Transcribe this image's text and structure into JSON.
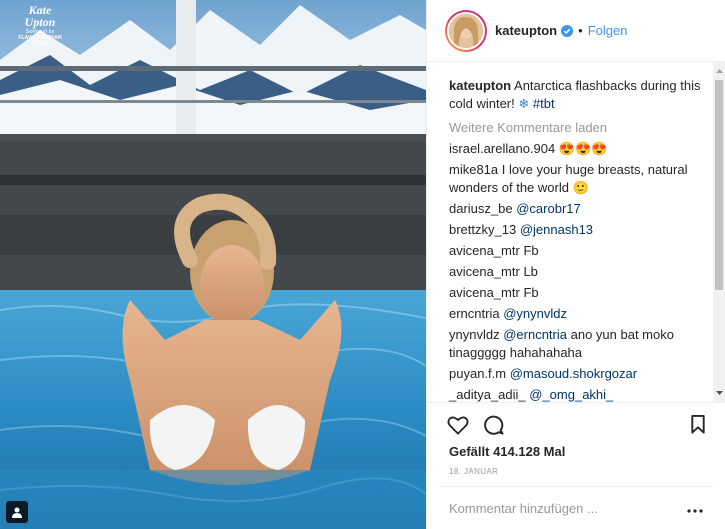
{
  "photo": {
    "watermark_title_1": "Kate",
    "watermark_title_2": "Upton",
    "watermark_line": "Swimsuit by",
    "watermark_brand": "FLAVIA PADOVAN",
    "watermark_code": "(Y260)",
    "tag_icon": "user-tag-icon"
  },
  "header": {
    "username": "kateupton",
    "verified_icon": "verified-badge-icon",
    "separator": "•",
    "follow_label": "Folgen"
  },
  "caption": {
    "user": "kateupton",
    "text": "Antarctica flashbacks during this cold winter!",
    "emoji": "❄",
    "hashtag": "#tbt"
  },
  "load_more_label": "Weitere Kommentare laden",
  "comments": [
    {
      "user": "israel.arellano.904",
      "mention": "",
      "text": "😍😍😍"
    },
    {
      "user": "mike81a",
      "mention": "",
      "text": "I love your huge breasts, natural wonders of the world 🙂"
    },
    {
      "user": "dariusz_be",
      "mention": "@carobr17",
      "text": ""
    },
    {
      "user": "brettzky_13",
      "mention": "@jennash13",
      "text": ""
    },
    {
      "user": "avicena_mtr",
      "mention": "",
      "text": "Fb"
    },
    {
      "user": "avicena_mtr",
      "mention": "",
      "text": "Lb"
    },
    {
      "user": "avicena_mtr",
      "mention": "",
      "text": "Fb"
    },
    {
      "user": "erncntria",
      "mention": "@ynynvldz",
      "text": ""
    },
    {
      "user": "ynynvldz",
      "mention": "@erncntria",
      "text": "ano yun bat moko tinaggggg hahahahaha"
    },
    {
      "user": "puyan.f.m",
      "mention": "@masoud.shokrgozar",
      "text": ""
    },
    {
      "user": "_aditya_adii_",
      "mention": "@_omg_akhi_",
      "text": ""
    }
  ],
  "actions": {
    "like_icon": "heart-icon",
    "comment_icon": "comment-bubble-icon",
    "save_icon": "bookmark-icon"
  },
  "likes_text": "Gefällt 414.128 Mal",
  "date_text": "18. JANUAR",
  "add_comment": {
    "placeholder": "Kommentar hinzufügen ...",
    "more_icon": "more-dots-icon"
  },
  "colors": {
    "link": "#3897f0",
    "mention": "#003569",
    "muted": "#999999",
    "water": "#2a86b8"
  }
}
